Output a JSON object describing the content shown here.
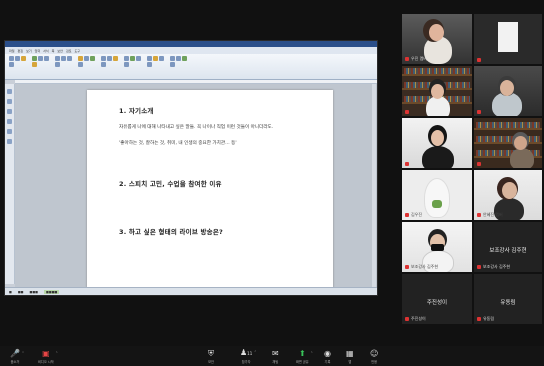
{
  "document": {
    "heading1": "1. 자기소개",
    "para1": "자유롭게 나에 대해 나타내고 싶은 말들. 꼭 나이나 직업 이런 것들이 아니더라도.",
    "para2": "'좋아하는 것, 잘하는 것, 취미, 내 인생의 중요한 가치관… 등'",
    "heading2": "2. 스피치 고민, 수업을 참여한 이유",
    "heading3": "3. 하고 싶은 형태의 라이브 방송은?",
    "menu": [
      "파일",
      "편집",
      "보기",
      "입력",
      "서식",
      "쪽",
      "보안",
      "검토",
      "도구"
    ]
  },
  "participants": [
    {
      "id": "p1",
      "name": "우진 멤버",
      "muted": true
    },
    {
      "id": "p2",
      "name": "",
      "muted": true
    },
    {
      "id": "p3",
      "name": "",
      "muted": true
    },
    {
      "id": "p4",
      "name": "",
      "muted": true
    },
    {
      "id": "p5",
      "name": "",
      "muted": true
    },
    {
      "id": "p6",
      "name": "",
      "muted": true
    },
    {
      "id": "p7",
      "name": "김우진",
      "muted": true
    },
    {
      "id": "p8",
      "name": "안혜진 멤버",
      "muted": true
    },
    {
      "id": "p9",
      "name": "보조강사 김주현",
      "muted": true
    },
    {
      "id": "p10",
      "name": "보조강사 김주현",
      "center": "보조강사 김주현",
      "muted": true
    },
    {
      "id": "p11",
      "name": "주진성이",
      "center": "주진성이",
      "muted": true
    },
    {
      "id": "p12",
      "name": "유동림",
      "center": "유동림",
      "muted": true
    }
  ],
  "toolbar": {
    "mute_label": "음소거",
    "video_label": "비디오 시작",
    "security_label": "보안",
    "participants_label": "참가자",
    "participants_count": "11",
    "chat_label": "채팅",
    "share_label": "화면 공유",
    "record_label": "기록",
    "reactions_label": "반응",
    "apps_label": "앱",
    "more_label": "종료"
  }
}
